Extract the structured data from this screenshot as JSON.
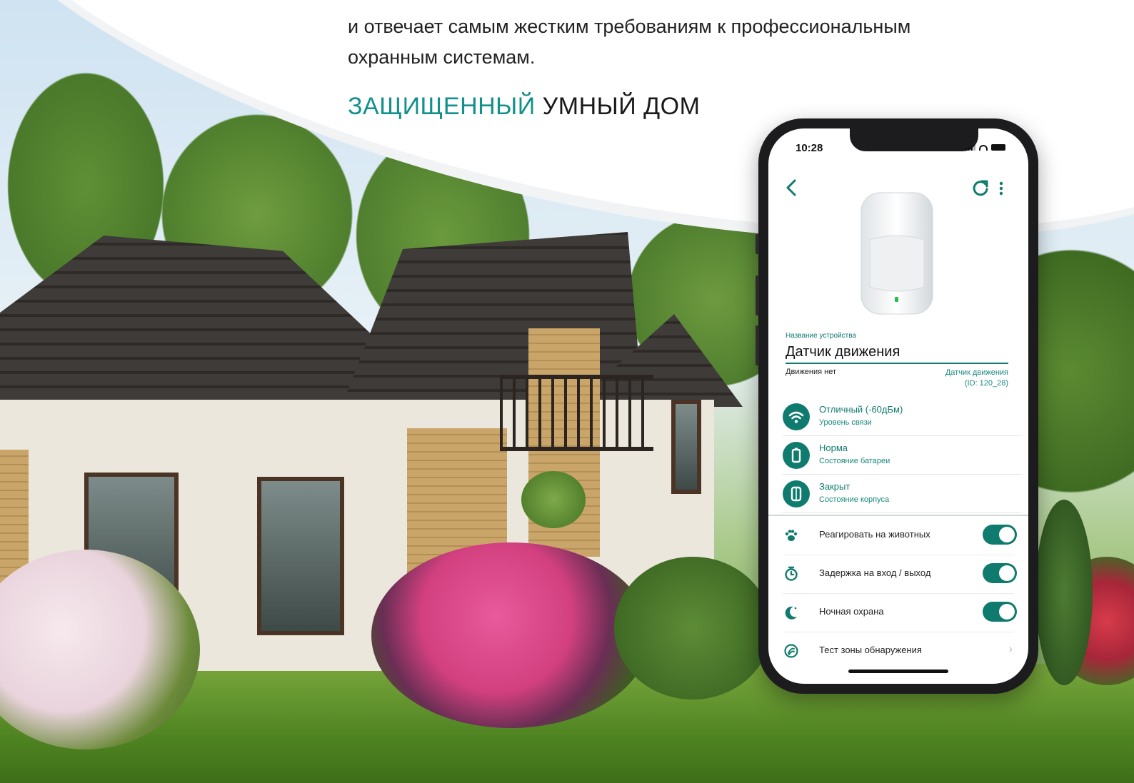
{
  "intro": {
    "line1": "",
    "line2": "и отвечает самым жестким требованиям к профессиональным",
    "line3": "охранным системам."
  },
  "tagline": {
    "accent": "ЗАЩИЩЕННЫЙ",
    "rest": " УМНЫЙ ДОМ"
  },
  "phone": {
    "status_bar": {
      "time": "10:28"
    },
    "device": {
      "name_label": "Название устройства",
      "name_value": "Датчик движения",
      "state": "Движения нет",
      "type_line1": "Датчик движения",
      "type_line2": "(ID: 120_28)"
    },
    "info": [
      {
        "title": "Отличный (-60дБм)",
        "subtitle": "Уровень связи",
        "icon": "wifi-icon"
      },
      {
        "title": "Норма",
        "subtitle": "Состояние батареи",
        "icon": "battery-icon"
      },
      {
        "title": "Закрыт",
        "subtitle": "Состояние корпуса",
        "icon": "enclosure-icon"
      }
    ],
    "settings": [
      {
        "label": "Реагировать на животных",
        "icon": "paw-icon",
        "enabled": true
      },
      {
        "label": "Задержка на вход / выход",
        "icon": "timer-icon",
        "enabled": true
      },
      {
        "label": "Ночная охрана",
        "icon": "moon-icon",
        "enabled": true
      },
      {
        "label": "Тест зоны обнаружения",
        "icon": "detection-test-icon",
        "chevron": "›"
      }
    ]
  },
  "colors": {
    "accent": "#0f7b6e",
    "accent_text": "#12908a"
  }
}
